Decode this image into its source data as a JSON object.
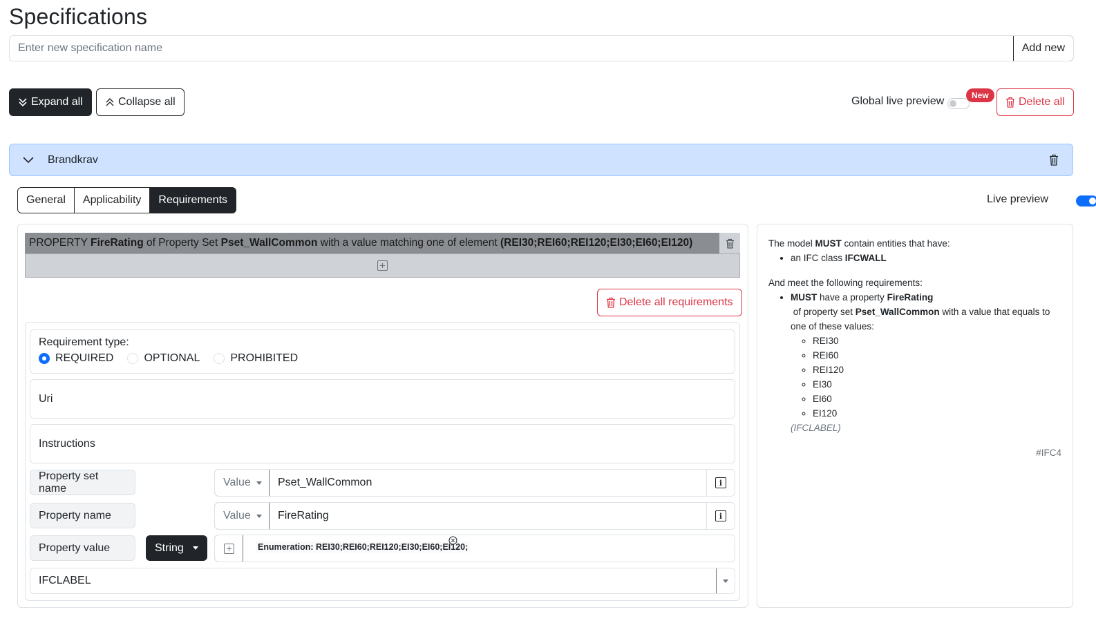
{
  "page": {
    "title": "Specifications"
  },
  "new_spec": {
    "placeholder": "Enter new specification name",
    "add_label": "Add new"
  },
  "toolbar": {
    "expand_all": "Expand all",
    "collapse_all": "Collapse all",
    "global_live_preview_label": "Global live preview",
    "global_live_preview_on": false,
    "new_badge": "New",
    "delete_all": "Delete all"
  },
  "specification": {
    "name": "Brandkrav",
    "tabs": [
      {
        "label": "General",
        "active": false
      },
      {
        "label": "Applicability",
        "active": false
      },
      {
        "label": "Requirements",
        "active": true
      }
    ],
    "live_preview_label": "Live preview",
    "live_preview_on": true
  },
  "requirement_summary": {
    "p1": "PROPERTY ",
    "b1": "FireRating",
    "p2": " of Property Set ",
    "b2": "Pset_WallCommon",
    "p3": " with a value matching one of element ",
    "b3": "(REI30;REI60;REI120;EI30;EI60;EI120)"
  },
  "requirements": {
    "delete_all_label": "Delete all requirements",
    "type_label": "Requirement type:",
    "types": [
      "REQUIRED",
      "OPTIONAL",
      "PROHIBITED"
    ],
    "selected_type": "REQUIRED",
    "uri_placeholder": "Uri",
    "instructions_placeholder": "Instructions",
    "property_set_label": "Property set name",
    "property_set_mode": "Value",
    "property_set_value": "Pset_WallCommon",
    "property_name_label": "Property name",
    "property_name_mode": "Value",
    "property_name_value": "FireRating",
    "property_value_label": "Property value",
    "property_value_type": "String",
    "enumeration_tag": "Enumeration: REI30;REI60;REI120;EI30;EI60;EI120;",
    "datatype": "IFCLABEL"
  },
  "preview": {
    "intro_pre": "The model ",
    "intro_must": "MUST",
    "intro_post": " contain entities that have:",
    "applicability_pre": "an IFC class ",
    "applicability_class": "IFCWALL",
    "requirements_intro": "And meet the following requirements:",
    "req_must": "MUST",
    "req_t1": " have a property ",
    "req_prop": "FireRating",
    "req_t2": " of property set ",
    "req_pset": "Pset_WallCommon",
    "req_t3": " with a value that equals to one of these values:",
    "values": [
      "REI30",
      "REI60",
      "REI120",
      "EI30",
      "EI60",
      "EI120"
    ],
    "datatype": "(IFCLABEL)",
    "ifc_version": "#IFC4"
  }
}
